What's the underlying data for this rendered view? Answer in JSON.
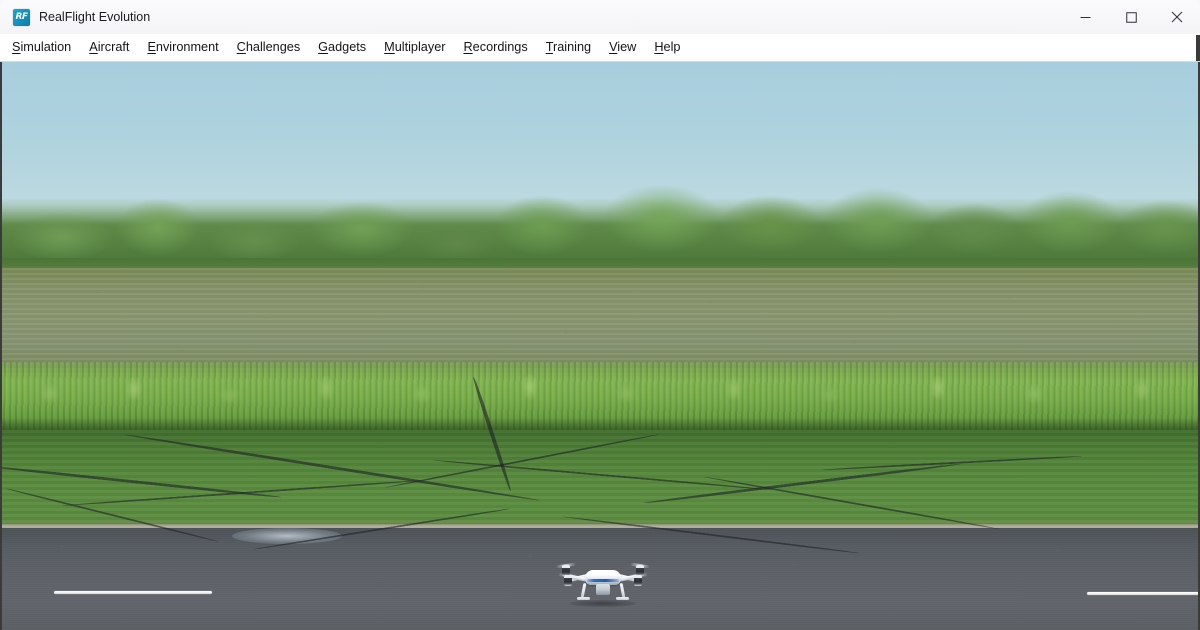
{
  "window": {
    "title": "RealFlight Evolution",
    "app_icon_name": "realflight-app-icon",
    "app_icon_text": "RF",
    "controls": {
      "minimize_label": "Minimize",
      "maximize_label": "Maximize",
      "close_label": "Close"
    }
  },
  "menu_bar": {
    "items": [
      {
        "label": "Simulation",
        "mnemonic": "S"
      },
      {
        "label": "Aircraft",
        "mnemonic": "A"
      },
      {
        "label": "Environment",
        "mnemonic": "E"
      },
      {
        "label": "Challenges",
        "mnemonic": "C"
      },
      {
        "label": "Gadgets",
        "mnemonic": "G"
      },
      {
        "label": "Multiplayer",
        "mnemonic": "M"
      },
      {
        "label": "Recordings",
        "mnemonic": "R"
      },
      {
        "label": "Training",
        "mnemonic": "T"
      },
      {
        "label": "View",
        "mnemonic": "V"
      },
      {
        "label": "Help",
        "mnemonic": "H"
      }
    ]
  },
  "viewport": {
    "scene_description": "Outdoor RC flying field — photographic backdrop with a quadcopter on the asphalt runway",
    "aircraft": {
      "name": "quadcopter-drone",
      "type": "quadcopter",
      "body_color": "#ffffff",
      "accent_color": "#2a6fc4"
    },
    "scene_colors": {
      "sky": "#aed2de",
      "treeline": "#5f8a48",
      "dry_field": "#8a9770",
      "tall_grass": "#7aab4e",
      "mowed_lawn": "#55873b",
      "asphalt": "#5e6268",
      "runway_marking": "#ffffff"
    }
  }
}
